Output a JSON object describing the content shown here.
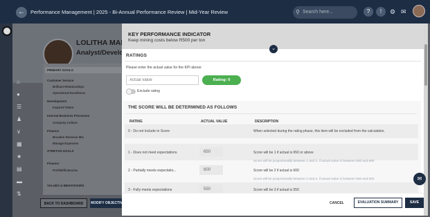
{
  "topbar": {
    "breadcrumb": "Performance Management | 2025 - Bi-Annual Performance Review | Mid-Year Review",
    "search_placeholder": "Search here...",
    "icons": [
      "back-arrow-icon",
      "search-icon",
      "help-icon",
      "alert-icon",
      "gear-icon",
      "mail-icon",
      "avatar"
    ]
  },
  "profile": {
    "name": "LOLITHA MAHOM",
    "role": "Analyst/Developer"
  },
  "goals": {
    "primary_label": "PRIMARY GOALS",
    "customer_service": "Customer Service",
    "brilliant_relationships": "Brilliant Relationships",
    "operational_excellence": "Operational Excellence",
    "development": "Development",
    "inspired_talent": "Inspired Talent",
    "internal_business": "Internal Business Processes",
    "company_culture": "Company Culture",
    "finance": "Finance",
    "broaden_revenue": "Broaden Revenue Mix",
    "manage_expenses": "Manage Expenses",
    "stretch_label": "STRETCH GOALS",
    "finance2": "Finance",
    "profit_efficiencies": "Profit/Efficiencies",
    "values_label": "VALUES & BEHAVIOURS"
  },
  "bottom": {
    "back_label": "BACK TO DASHBOARD",
    "modify_label": "MODIFY OBJECTIV"
  },
  "modal": {
    "title": "KEY PERFORMANCE INDICATOR",
    "subtitle": "Keep mining costs below R500 per ton",
    "ratings_label": "RATINGS",
    "prompt": "Please enter the actual value for the KPI above:",
    "actual_placeholder": "Actual value",
    "rating_pill": "Rating: 0",
    "exclude_label": "Exclude rating",
    "score_heading": "THE SCORE WILL BE DETERMINED AS FOLLOWS",
    "col_rating": "RATING",
    "col_actual": "ACTUAL VALUE",
    "col_desc": "DESCRIPTION",
    "rows": [
      {
        "rating": "0 - Do not include in Score",
        "actual": "",
        "desc": "When selected during the rating phase, this item will be excluded from the calculation.",
        "desc2": ""
      },
      {
        "rating": "1 - Does not meet expectations",
        "actual": "650",
        "desc": "Score will be 1 if actual is 650 or above",
        "desc2": "Score will be proportionally between 1 and 2, if actual value is between 600 and 650"
      },
      {
        "rating": "2 - Partially meets expectatio...",
        "actual": "600",
        "desc": "Score will be 2 if actual is 600",
        "desc2": "Score will be proportionally between 2 and 3, if actual value is between 550 and 600"
      },
      {
        "rating": "3 - Fully meets expectations",
        "actual": "550",
        "desc": "Score will be 3 if actual is 550",
        "desc2": ""
      }
    ],
    "cancel_label": "CANCEL",
    "eval_label": "EVALUATION SUMMARY",
    "save_label": "SAVE"
  }
}
